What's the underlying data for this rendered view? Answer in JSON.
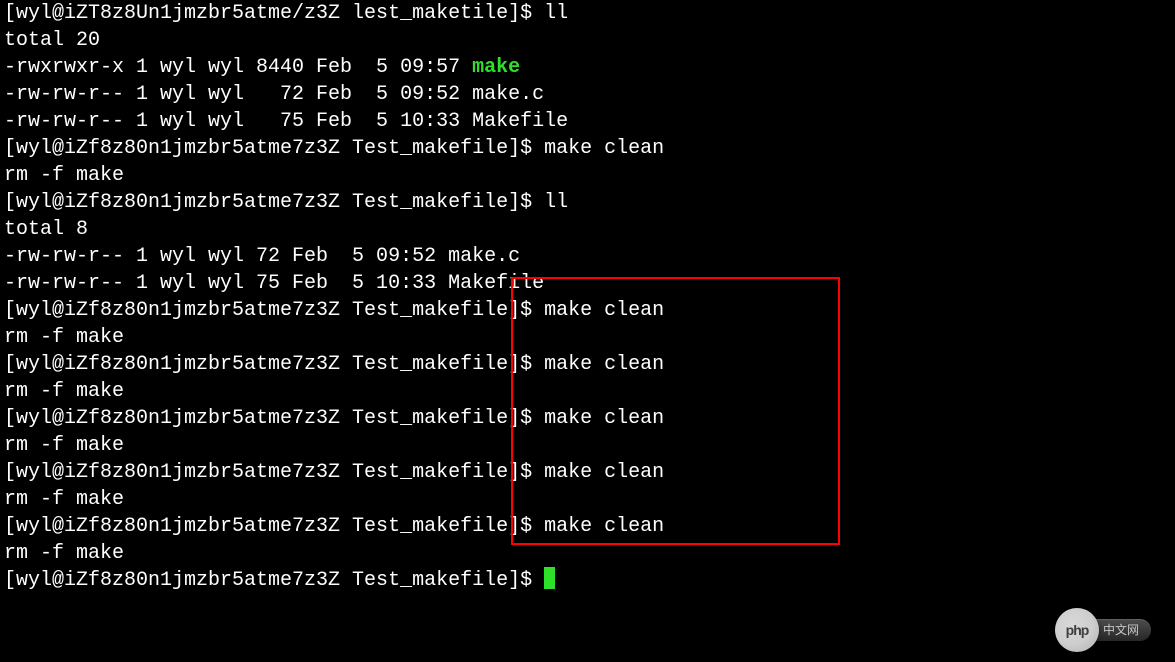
{
  "terminal": {
    "lines": [
      {
        "segments": [
          {
            "t": "[wyl@iZT8z8Un1jmzbr5atme/z3Z lest_maketile]$ ll"
          }
        ]
      },
      {
        "segments": [
          {
            "t": "total 20"
          }
        ]
      },
      {
        "segments": [
          {
            "t": "-rwxrwxr-x 1 wyl wyl 8440 Feb  5 09:57 "
          },
          {
            "t": "make",
            "cls": "green"
          }
        ]
      },
      {
        "segments": [
          {
            "t": "-rw-rw-r-- 1 wyl wyl   72 Feb  5 09:52 make.c"
          }
        ]
      },
      {
        "segments": [
          {
            "t": "-rw-rw-r-- 1 wyl wyl   75 Feb  5 10:33 Makefile"
          }
        ]
      },
      {
        "segments": [
          {
            "t": "[wyl@iZf8z80n1jmzbr5atme7z3Z Test_makefile]$ make clean"
          }
        ]
      },
      {
        "segments": [
          {
            "t": "rm -f make"
          }
        ]
      },
      {
        "segments": [
          {
            "t": "[wyl@iZf8z80n1jmzbr5atme7z3Z Test_makefile]$ ll"
          }
        ]
      },
      {
        "segments": [
          {
            "t": "total 8"
          }
        ]
      },
      {
        "segments": [
          {
            "t": "-rw-rw-r-- 1 wyl wyl 72 Feb  5 09:52 make.c"
          }
        ]
      },
      {
        "segments": [
          {
            "t": "-rw-rw-r-- 1 wyl wyl 75 Feb  5 10:33 Makefile"
          }
        ]
      },
      {
        "segments": [
          {
            "t": "[wyl@iZf8z80n1jmzbr5atme7z3Z Test_makefile]$ make clean"
          }
        ]
      },
      {
        "segments": [
          {
            "t": "rm -f make"
          }
        ]
      },
      {
        "segments": [
          {
            "t": "[wyl@iZf8z80n1jmzbr5atme7z3Z Test_makefile]$ make clean"
          }
        ]
      },
      {
        "segments": [
          {
            "t": "rm -f make"
          }
        ]
      },
      {
        "segments": [
          {
            "t": "[wyl@iZf8z80n1jmzbr5atme7z3Z Test_makefile]$ make clean"
          }
        ]
      },
      {
        "segments": [
          {
            "t": "rm -f make"
          }
        ]
      },
      {
        "segments": [
          {
            "t": "[wyl@iZf8z80n1jmzbr5atme7z3Z Test_makefile]$ make clean"
          }
        ]
      },
      {
        "segments": [
          {
            "t": "rm -f make"
          }
        ]
      },
      {
        "segments": [
          {
            "t": "[wyl@iZf8z80n1jmzbr5atme7z3Z Test_makefile]$ make clean"
          }
        ]
      },
      {
        "segments": [
          {
            "t": "rm -f make"
          }
        ]
      },
      {
        "segments": [
          {
            "t": "[wyl@iZf8z80n1jmzbr5atme7z3Z Test_makefile]$ "
          }
        ],
        "cursor": true
      }
    ]
  },
  "watermark": {
    "logo_text": "php",
    "label": "中文网"
  }
}
